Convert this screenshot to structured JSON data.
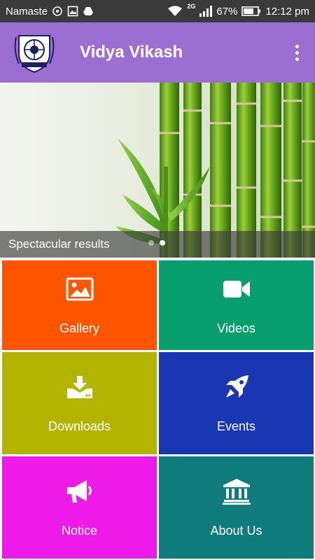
{
  "status_bar": {
    "carrier": "Namaste",
    "network": "2G",
    "battery": "67%",
    "time": "12:12 pm"
  },
  "app_bar": {
    "title": "Vidya Vikash"
  },
  "banner": {
    "caption": "Spectacular results",
    "slide_count": 2,
    "active_slide": 2
  },
  "tiles": [
    {
      "label": "Gallery",
      "icon": "image-icon",
      "color": "#ff5500"
    },
    {
      "label": "Videos",
      "icon": "video-camera-icon",
      "color": "#079e6e"
    },
    {
      "label": "Downloads",
      "icon": "download-icon",
      "color": "#b3b400"
    },
    {
      "label": "Events",
      "icon": "rocket-icon",
      "color": "#1a37b3"
    },
    {
      "label": "Notice",
      "icon": "megaphone-icon",
      "color": "#ee1be8"
    },
    {
      "label": "About Us",
      "icon": "institution-icon",
      "color": "#0f7b7d"
    }
  ]
}
